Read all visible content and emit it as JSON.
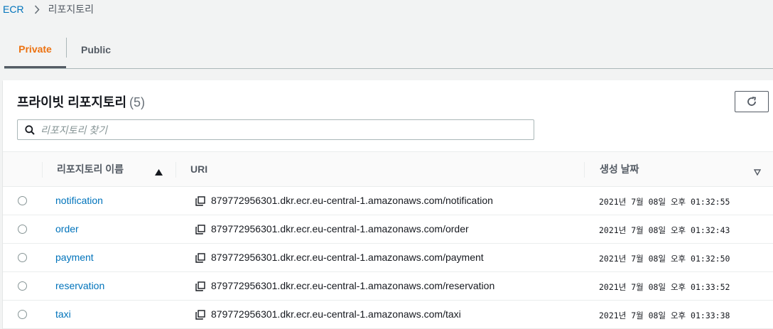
{
  "breadcrumb": {
    "root": "ECR",
    "current": "리포지토리"
  },
  "tabs": [
    {
      "label": "Private",
      "active": true
    },
    {
      "label": "Public",
      "active": false
    }
  ],
  "panel": {
    "title": "프라이빗 리포지토리",
    "count": "(5)",
    "search_placeholder": "리포지토리 찾기"
  },
  "table": {
    "columns": {
      "name": "리포지토리 이름",
      "uri": "URI",
      "created": "생성 날짜"
    },
    "rows": [
      {
        "name": "notification",
        "uri": "879772956301.dkr.ecr.eu-central-1.amazonaws.com/notification",
        "created": "2021년 7월 08일 오후 01:32:55"
      },
      {
        "name": "order",
        "uri": "879772956301.dkr.ecr.eu-central-1.amazonaws.com/order",
        "created": "2021년 7월 08일 오후 01:32:43"
      },
      {
        "name": "payment",
        "uri": "879772956301.dkr.ecr.eu-central-1.amazonaws.com/payment",
        "created": "2021년 7월 08일 오후 01:32:50"
      },
      {
        "name": "reservation",
        "uri": "879772956301.dkr.ecr.eu-central-1.amazonaws.com/reservation",
        "created": "2021년 7월 08일 오후 01:33:52"
      },
      {
        "name": "taxi",
        "uri": "879772956301.dkr.ecr.eu-central-1.amazonaws.com/taxi",
        "created": "2021년 7월 08일 오후 01:33:38"
      }
    ]
  },
  "colors": {
    "accent": "#ec7211",
    "link": "#0073bb",
    "text": "#16191f",
    "muted": "#545b64"
  },
  "icons": {
    "breadcrumb_separator": "chevron-right-icon",
    "refresh": "refresh-icon",
    "search": "search-icon",
    "copy": "copy-icon",
    "sort_asc": "sort-ascending-icon",
    "sort_desc": "sort-descending-icon"
  }
}
